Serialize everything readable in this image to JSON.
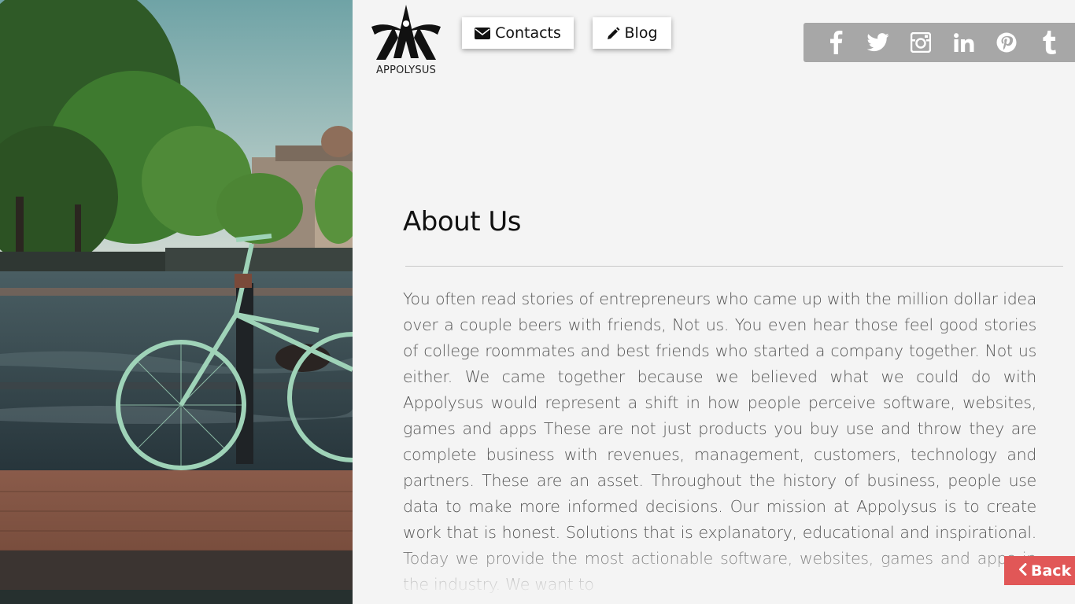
{
  "brand": {
    "name": "APPOLYSUS"
  },
  "nav": {
    "contacts_label": "Contacts",
    "blog_label": "Blog"
  },
  "social": {
    "icons": [
      "facebook-icon",
      "twitter-icon",
      "instagram-icon",
      "linkedin-icon",
      "pinterest-icon",
      "tumblr-icon"
    ]
  },
  "about": {
    "title": "About Us",
    "body": "You often read stories of entrepreneurs who came up with the million dollar idea over a couple beers with friends, Not us. You even hear those feel good stories of college roommates and best friends who started a company together. Not us either. We came together because we believed what we could do with Appolysus would represent a shift in how people perceive software, websites, games and apps These are not just products you buy use and throw they are complete business with revenues, management, customers, technology and partners. These are an asset. Throughout the history of business, people use data to make more informed decisions. Our mission at Appolysus is to create work that is honest. Solutions that is explanatory, educational and inspirational. Today we provide the most actionable software, websites, games and apps in the industry. We want to"
  },
  "back": {
    "label": "Back"
  },
  "colors": {
    "accent_red": "#e15757",
    "social_bar": "#a7a7a7",
    "background": "#f4f4f4"
  }
}
